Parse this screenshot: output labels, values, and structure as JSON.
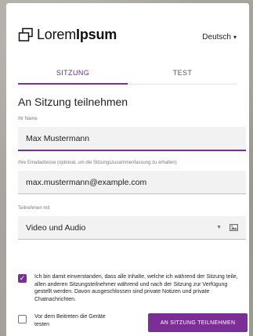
{
  "header": {
    "logo_light": "Lorem",
    "logo_bold": "Ipsum",
    "language": "Deutsch"
  },
  "tabs": [
    {
      "label": "SITZUNG",
      "active": true
    },
    {
      "label": "TEST",
      "active": false
    }
  ],
  "form": {
    "title": "An Sitzung teilnehmen",
    "name_label": "Ihr Name",
    "name_value": "Max Mustermann",
    "email_label": "Ihre Emailadresse (optional, um die Sitzungszusammenfassung zu erhalten)",
    "email_value": "max.mustermann@example.com",
    "mode_label": "Teilnehmen mit",
    "mode_value": "Video und Audio"
  },
  "consent": {
    "checked": true,
    "text": "Ich bin damit einverstanden, dass alle Inhalte, welche ich während der Sitzung teile, allen anderen Sitzungsteilnehmer während und nach der Sitzung zur Verfügung gestellt werden. Davon ausgeschlossen sind private Notizen und private Chatnachrichten."
  },
  "test_option": {
    "checked": false,
    "text": "Vor dem Beitreten die Geräte testen"
  },
  "join_button": "AN SITZUNG TEILNEHMEN",
  "colors": {
    "accent": "#7b2e96",
    "field_bg": "#f2f2f2"
  },
  "icons": {
    "logo": "window-stack-icon",
    "select": "chevron-down-icon",
    "preview": "image-icon"
  }
}
